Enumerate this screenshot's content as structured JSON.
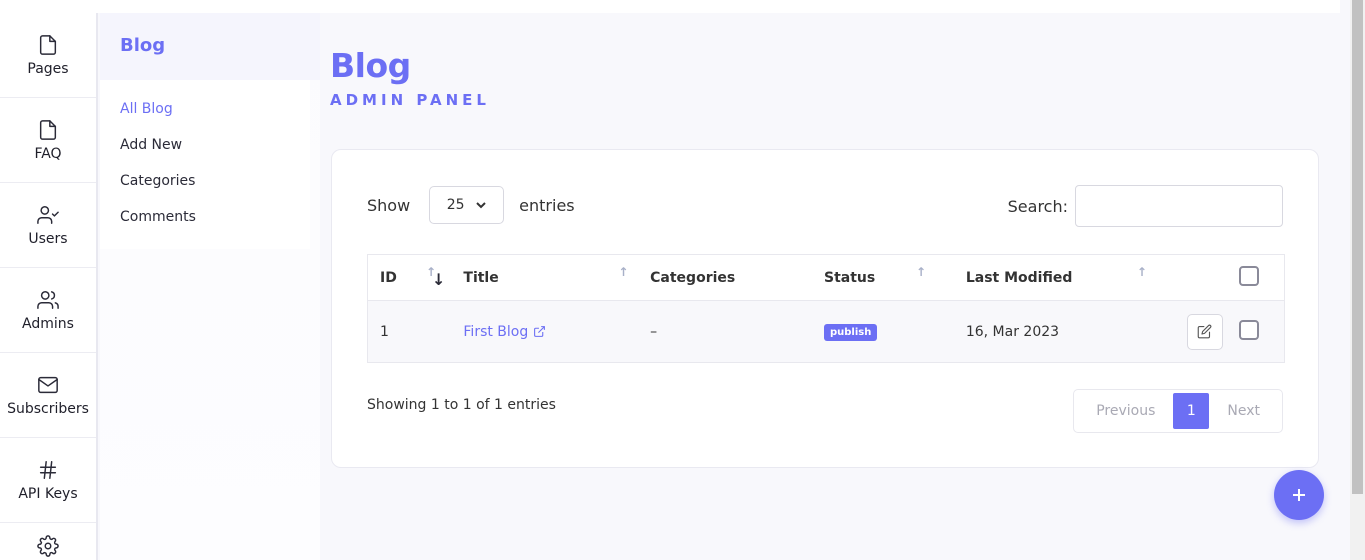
{
  "rail": {
    "items": [
      {
        "label": "Pages",
        "icon": "file-icon"
      },
      {
        "label": "FAQ",
        "icon": "file-icon"
      },
      {
        "label": "Users",
        "icon": "user-check-icon"
      },
      {
        "label": "Admins",
        "icon": "users-icon"
      },
      {
        "label": "Subscribers",
        "icon": "mail-icon"
      },
      {
        "label": "API Keys",
        "icon": "hash-icon"
      },
      {
        "label": "",
        "icon": "gear-icon"
      }
    ]
  },
  "submenu": {
    "title": "Blog",
    "links": [
      "All Blog",
      "Add New",
      "Categories",
      "Comments"
    ]
  },
  "header": {
    "title": "Blog",
    "subtitle": "ADMIN PANEL"
  },
  "controls": {
    "show_label": "Show",
    "entries_value": "25",
    "entries_label": "entries",
    "search_label": "Search:",
    "search_value": ""
  },
  "table": {
    "columns": [
      "ID",
      "Title",
      "Categories",
      "Status",
      "Last Modified"
    ],
    "rows": [
      {
        "id": "1",
        "title": "First Blog",
        "categories": "–",
        "status": "publish",
        "modified": "16, Mar 2023"
      }
    ]
  },
  "footer": {
    "info": "Showing 1 to 1 of 1 entries",
    "prev": "Previous",
    "page": "1",
    "next": "Next"
  },
  "colors": {
    "accent": "#6c6ff4"
  }
}
